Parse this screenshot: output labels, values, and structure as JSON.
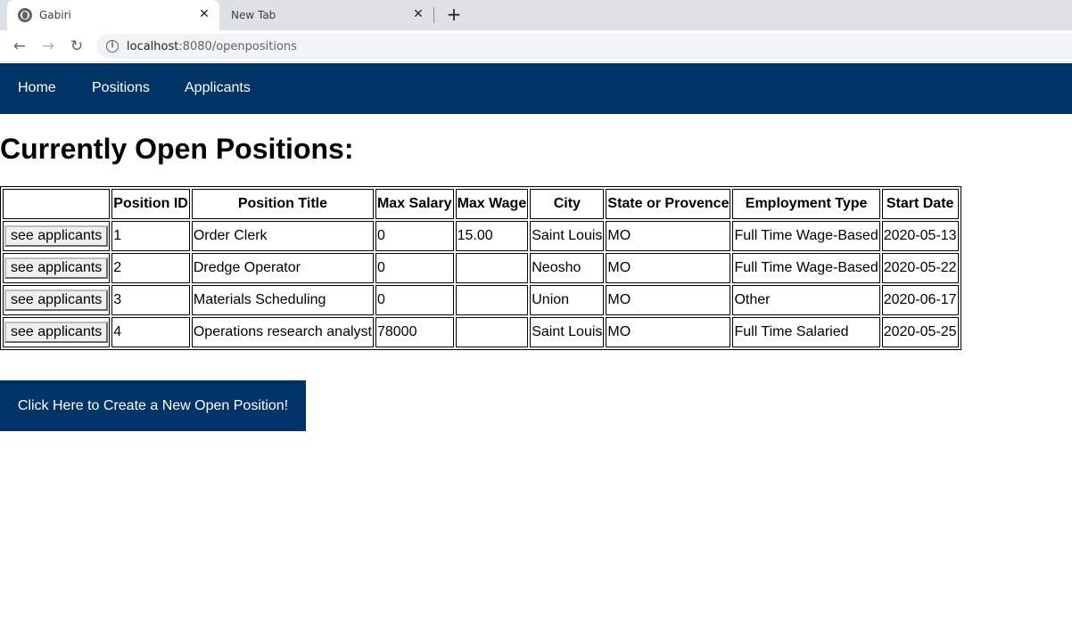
{
  "browser": {
    "tabs": [
      {
        "title": "Gabiri",
        "active": true
      },
      {
        "title": "New Tab",
        "active": false
      }
    ],
    "close_glyph": "✕",
    "new_tab_glyph": "+",
    "url_host": "localhost",
    "url_path": ":8080/openpositions"
  },
  "nav": {
    "home": "Home",
    "positions": "Positions",
    "applicants": "Applicants"
  },
  "page": {
    "heading": "Currently Open Positions:"
  },
  "table": {
    "headers": [
      "",
      "Position ID",
      "Position Title",
      "Max Salary",
      "Max Wage",
      "City",
      "State or Provence",
      "Employment Type",
      "Start Date"
    ],
    "action_label": "see applicants",
    "rows": [
      {
        "id": "1",
        "title": "Order Clerk",
        "max_salary": "0",
        "max_wage": "15.00",
        "city": "Saint Louis",
        "state": "MO",
        "type": "Full Time Wage-Based",
        "start": "2020-05-13"
      },
      {
        "id": "2",
        "title": "Dredge Operator",
        "max_salary": "0",
        "max_wage": "",
        "city": "Neosho",
        "state": "MO",
        "type": "Full Time Wage-Based",
        "start": "2020-05-22"
      },
      {
        "id": "3",
        "title": "Materials Scheduling",
        "max_salary": "0",
        "max_wage": "",
        "city": "Union",
        "state": "MO",
        "type": "Other",
        "start": "2020-06-17"
      },
      {
        "id": "4",
        "title": "Operations research analyst",
        "max_salary": "78000",
        "max_wage": "",
        "city": "Saint Louis",
        "state": "MO",
        "type": "Full Time Salaried",
        "start": "2020-05-25"
      }
    ]
  },
  "create_button": "Click Here to Create a New Open Position!",
  "colors": {
    "brand": "#003366",
    "tabstrip": "#dee1e6"
  },
  "icons": [
    "globe-icon",
    "close-icon",
    "plus-icon",
    "back-arrow-icon",
    "forward-arrow-icon",
    "reload-icon",
    "info-icon"
  ]
}
